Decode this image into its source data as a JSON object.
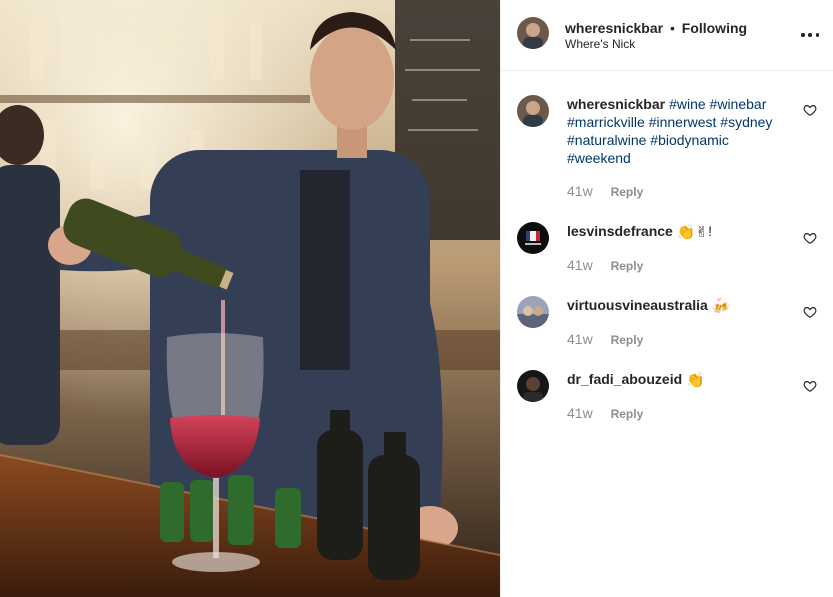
{
  "post": {
    "username": "wheresnickbar",
    "separator": "•",
    "follow_status": "Following",
    "location": "Where's Nick",
    "more_label": "More options"
  },
  "caption": {
    "username": "wheresnickbar",
    "hashtags": [
      "#wine",
      "#winebar",
      "#marrickville",
      "#innerwest",
      "#sydney",
      "#naturalwine",
      "#biodynamic",
      "#weekend"
    ],
    "age": "41w",
    "reply_label": "Reply"
  },
  "comments": [
    {
      "username": "lesvinsdefrance",
      "text": "👏✌",
      "suffix": "!",
      "age": "41w",
      "reply_label": "Reply"
    },
    {
      "username": "virtuousvineaustralia",
      "text": "🍻",
      "suffix": "",
      "age": "41w",
      "reply_label": "Reply"
    },
    {
      "username": "dr_fadi_abouzeid",
      "text": "👏",
      "suffix": "",
      "age": "41w",
      "reply_label": "Reply"
    }
  ],
  "colors": {
    "text": "#262626",
    "hashtag": "#00376b",
    "muted": "#8e8e8e",
    "divider": "#efefef"
  },
  "icons": {
    "more": "three-dots-icon",
    "like": "heart-icon"
  }
}
